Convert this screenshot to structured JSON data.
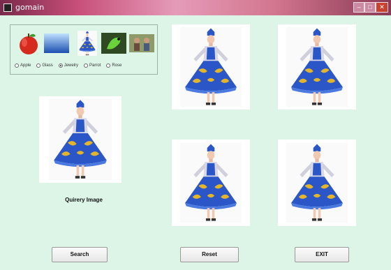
{
  "window": {
    "title": "gomain"
  },
  "categories": [
    {
      "label": "Apple",
      "selected": false,
      "icon": "apple"
    },
    {
      "label": "Glass",
      "selected": false,
      "icon": "glass"
    },
    {
      "label": "Jewelry",
      "selected": true,
      "icon": "dancer"
    },
    {
      "label": "Parrot",
      "selected": false,
      "icon": "parrot"
    },
    {
      "label": "Rose",
      "selected": false,
      "icon": "people"
    }
  ],
  "query": {
    "caption": "Quirery Image"
  },
  "buttons": {
    "search": "Search",
    "reset": "Reset",
    "exit": "EXIT"
  },
  "colors": {
    "background": "#dcf5e6",
    "dress_blue": "#2a56c8",
    "dress_gold": "#e3b52a"
  }
}
